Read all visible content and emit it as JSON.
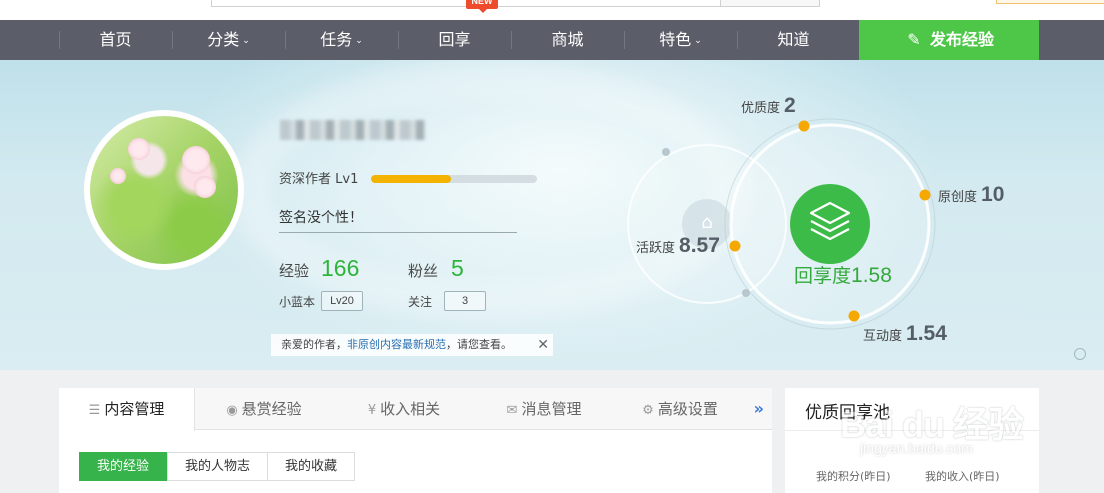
{
  "nav": {
    "items": [
      {
        "label": "首页",
        "caret": false
      },
      {
        "label": "分类",
        "caret": true
      },
      {
        "label": "任务",
        "caret": true
      },
      {
        "label": "回享",
        "caret": false
      },
      {
        "label": "商城",
        "caret": false
      },
      {
        "label": "特色",
        "caret": true
      },
      {
        "label": "知道",
        "caret": false
      }
    ],
    "new_badge": "NEW",
    "publish_label": "发布经验",
    "publish_color": "#4ec748",
    "bar_color": "#5b5e69"
  },
  "profile": {
    "level_label": "资深作者 Lv1",
    "level_progress": 0.48,
    "signature": "签名没个性！",
    "exp_label": "经验",
    "exp_value": "166",
    "fans_label": "粉丝",
    "fans_value": "5",
    "blue_label": "小蓝本",
    "blue_value": "Lv20",
    "follow_label": "关注",
    "follow_value": "3",
    "notice_prefix": "亲爱的作者，",
    "notice_link": "非原创内容最新规范",
    "notice_suffix": "，请您查看。",
    "notice_close": "✕"
  },
  "scores": {
    "quality_label": "优质度",
    "quality_value": "2",
    "original_label": "原创度",
    "original_value": "10",
    "activity_label": "活跃度",
    "activity_value": "8.57",
    "interaction_label": "互动度",
    "interaction_value": "1.54",
    "share_label": "回享度",
    "share_value": "1.58",
    "accent": "#f5a800",
    "green": "#3dbb48"
  },
  "tabs": [
    {
      "icon": "list-icon",
      "glyph": "☰",
      "label": "内容管理",
      "active": true
    },
    {
      "icon": "reward-icon",
      "glyph": "◉",
      "label": "悬赏经验",
      "active": false
    },
    {
      "icon": "yen-icon",
      "glyph": "¥",
      "label": "收入相关",
      "active": false
    },
    {
      "icon": "mail-icon",
      "glyph": "✉",
      "label": "消息管理",
      "active": false
    },
    {
      "icon": "gear-icon",
      "glyph": "⚙",
      "label": "高级设置",
      "active": false
    }
  ],
  "tabs_more": "»",
  "subtabs": [
    {
      "label": "我的经验",
      "active": true
    },
    {
      "label": "我的人物志",
      "active": false
    },
    {
      "label": "我的收藏",
      "active": false
    }
  ],
  "side": {
    "title": "优质回享池",
    "points_label": "我的积分(昨日)",
    "income_label": "我的收入(昨日)"
  },
  "watermark": {
    "text": "Bai du 经验",
    "url": "jingyan.baidu.com"
  }
}
